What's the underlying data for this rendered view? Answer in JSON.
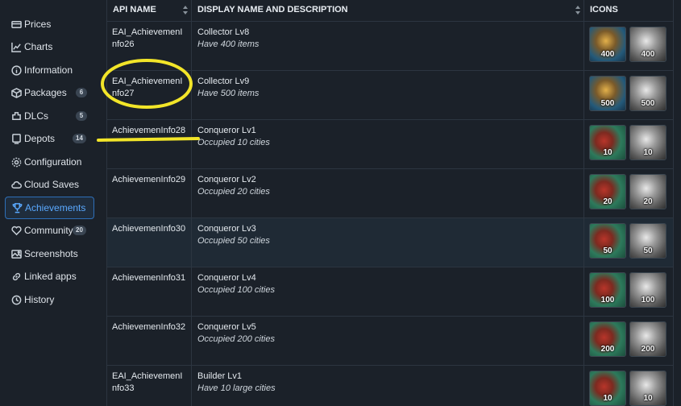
{
  "sidebar": {
    "items": [
      {
        "label": "Prices",
        "icon": "prices-icon"
      },
      {
        "label": "Charts",
        "icon": "chart-icon"
      },
      {
        "label": "Information",
        "icon": "info-icon"
      },
      {
        "label": "Packages",
        "icon": "package-icon",
        "badge": "6"
      },
      {
        "label": "DLCs",
        "icon": "dlc-icon",
        "badge": "5"
      },
      {
        "label": "Depots",
        "icon": "depot-icon",
        "badge": "14"
      },
      {
        "label": "Configuration",
        "icon": "gear-icon"
      },
      {
        "label": "Cloud Saves",
        "icon": "cloud-icon"
      },
      {
        "label": "Achievements",
        "icon": "trophy-icon",
        "active": true
      },
      {
        "label": "Community",
        "icon": "heart-icon",
        "badge": "20"
      },
      {
        "label": "Screenshots",
        "icon": "image-icon"
      },
      {
        "label": "Linked apps",
        "icon": "link-icon"
      },
      {
        "label": "History",
        "icon": "history-icon"
      }
    ]
  },
  "table": {
    "headers": {
      "api_name": "API NAME",
      "display": "DISPLAY NAME AND DESCRIPTION",
      "icons": "ICONS"
    },
    "rows": [
      {
        "api": "EAI_AchievemenInfo26",
        "name": "Collector Lv8",
        "desc": "Have 400 items",
        "icon_label": "400",
        "theme": "color"
      },
      {
        "api": "EAI_AchievemenInfo27",
        "name": "Collector Lv9",
        "desc": "Have 500 items",
        "icon_label": "500",
        "theme": "color"
      },
      {
        "api": "AchievemenInfo28",
        "name": "Conqueror Lv1",
        "desc": "Occupied 10 cities",
        "icon_label": "10",
        "theme": "c-green"
      },
      {
        "api": "AchievemenInfo29",
        "name": "Conqueror Lv2",
        "desc": "Occupied 20 cities",
        "icon_label": "20",
        "theme": "c-green"
      },
      {
        "api": "AchievemenInfo30",
        "name": "Conqueror Lv3",
        "desc": "Occupied 50 cities",
        "icon_label": "50",
        "theme": "c-green",
        "highlight": true
      },
      {
        "api": "AchievemenInfo31",
        "name": "Conqueror Lv4",
        "desc": "Occupied 100 cities",
        "icon_label": "100",
        "theme": "c-green"
      },
      {
        "api": "AchievemenInfo32",
        "name": "Conqueror Lv5",
        "desc": "Occupied 200 cities",
        "icon_label": "200",
        "theme": "c-green"
      },
      {
        "api": "EAI_AchievemenInfo33",
        "name": "Builder Lv1",
        "desc": "Have 10 large cities",
        "icon_label": "10",
        "theme": "c-green"
      }
    ]
  },
  "colors": {
    "background": "#1b2129",
    "accent": "#5aa9ff",
    "annotation": "#f2e529"
  }
}
